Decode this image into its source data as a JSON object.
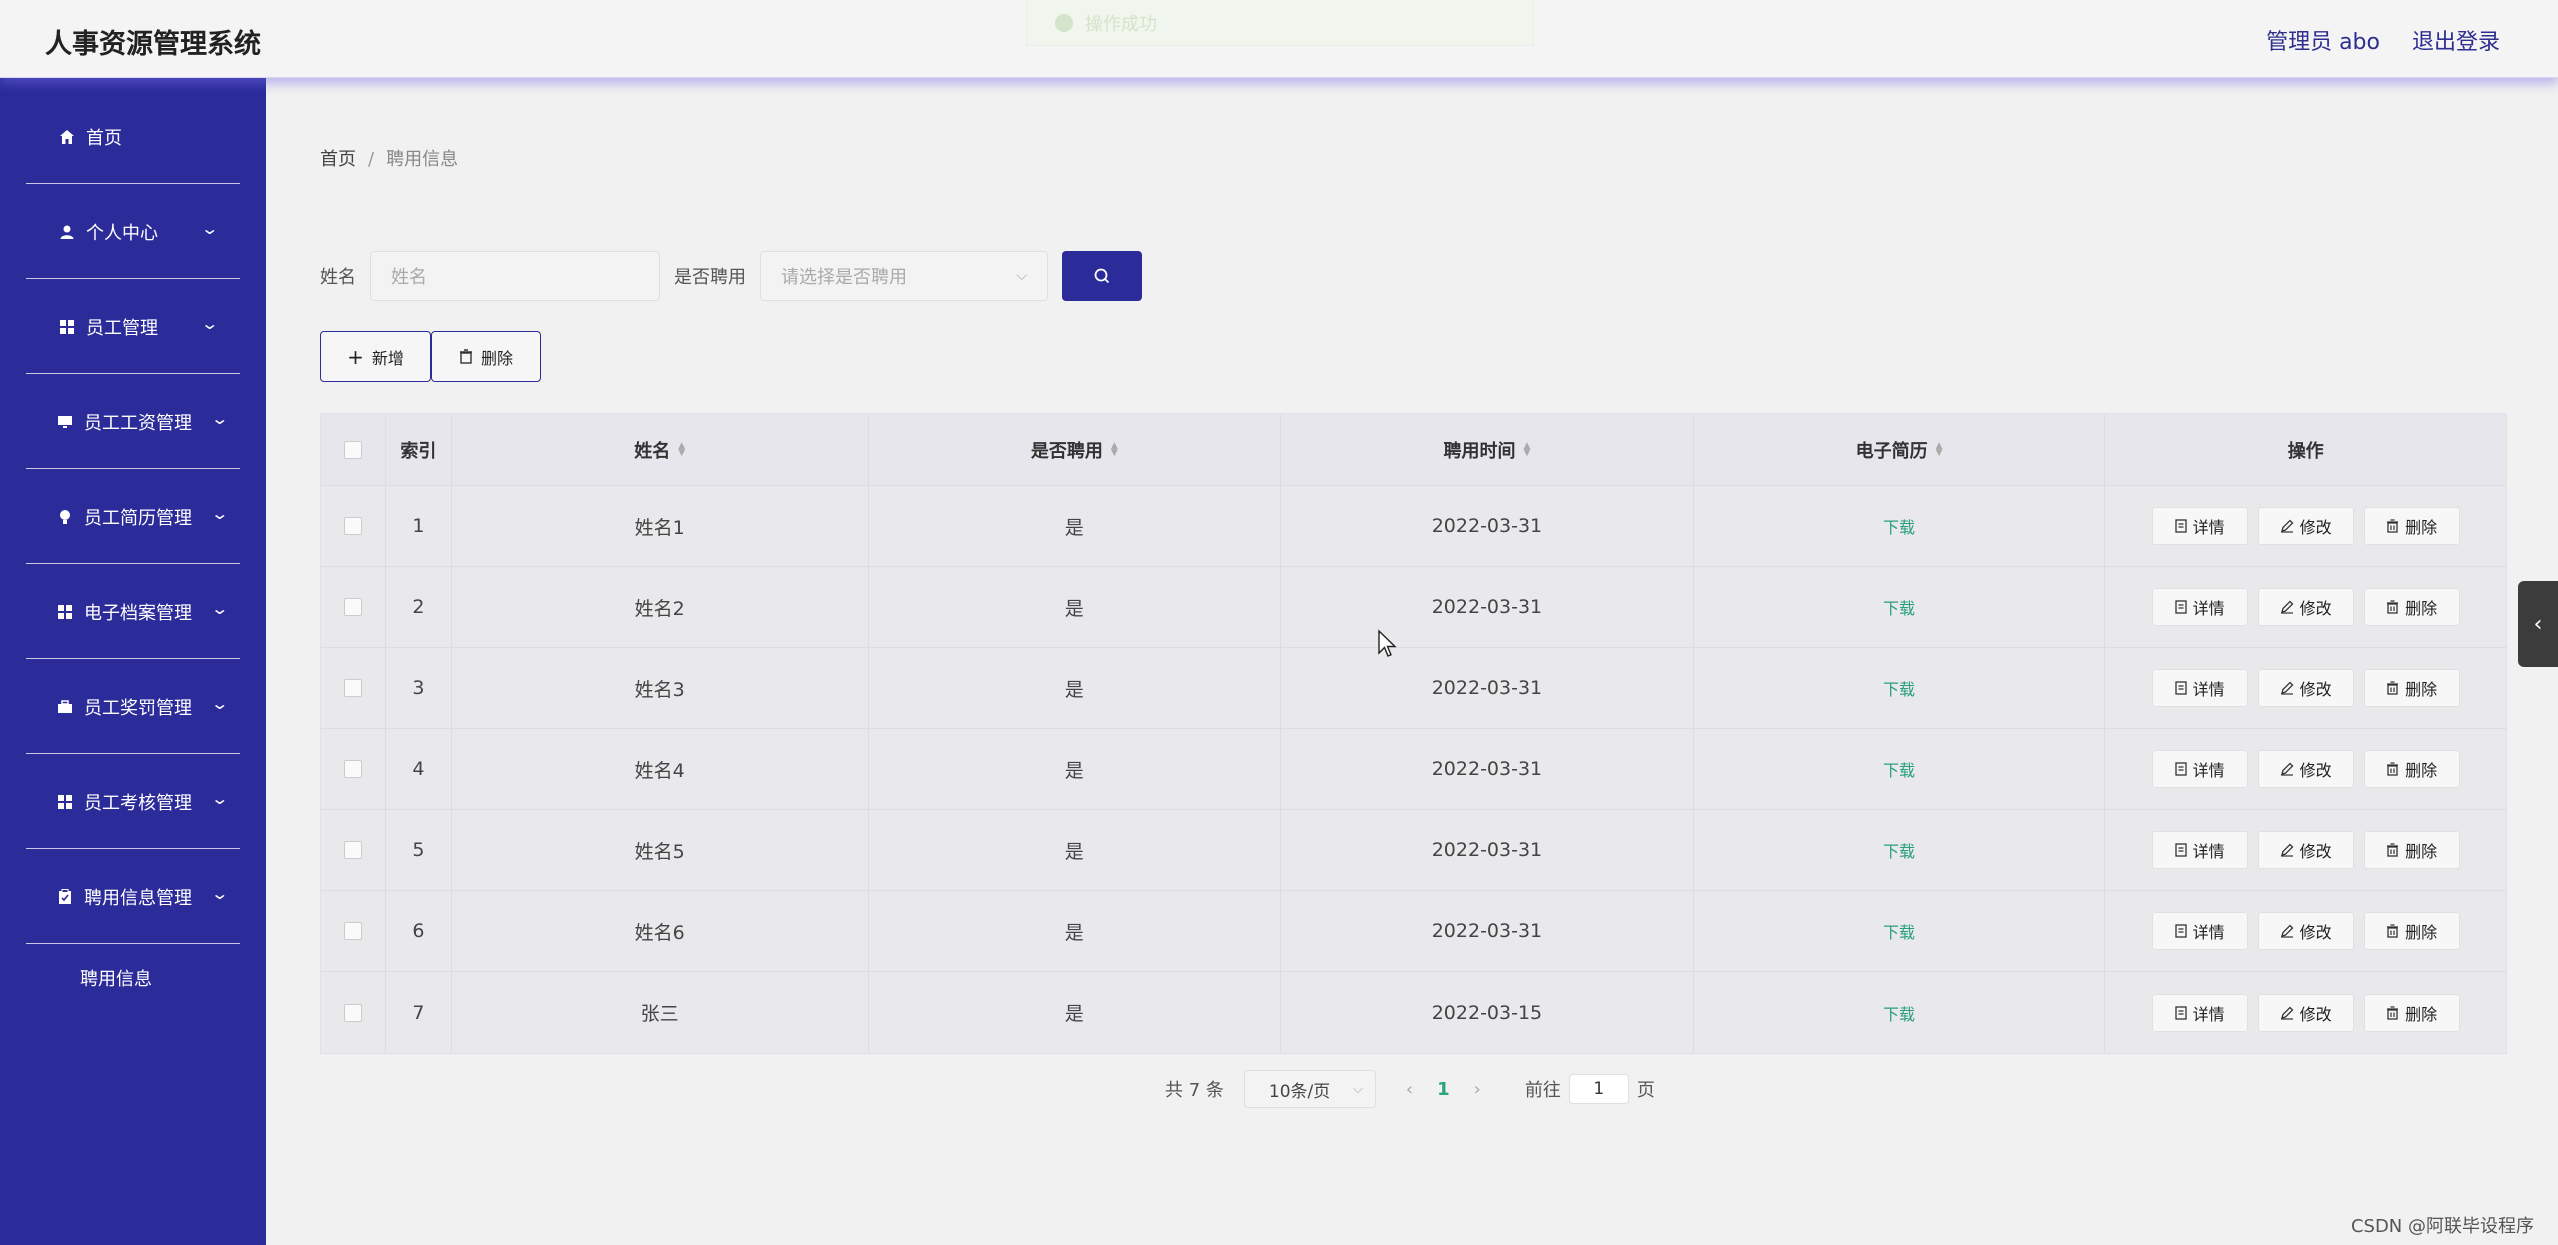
{
  "header": {
    "title": "人事资源管理系统",
    "toast": "操作成功",
    "user": "管理员 abo",
    "logout": "退出登录"
  },
  "sidebar": {
    "items": [
      {
        "label": "首页",
        "icon": "home-icon"
      },
      {
        "label": "个人中心",
        "icon": "user-icon"
      },
      {
        "label": "员工管理",
        "icon": "grid-icon"
      },
      {
        "label": "员工工资管理",
        "icon": "monitor-icon"
      },
      {
        "label": "员工简历管理",
        "icon": "bulb-icon"
      },
      {
        "label": "电子档案管理",
        "icon": "grid-icon"
      },
      {
        "label": "员工奖罚管理",
        "icon": "briefcase-icon"
      },
      {
        "label": "员工考核管理",
        "icon": "grid-icon"
      },
      {
        "label": "聘用信息管理",
        "icon": "clipboard-icon"
      }
    ],
    "sub_item": "聘用信息"
  },
  "breadcrumb": {
    "home": "首页",
    "sep": "/",
    "current": "聘用信息"
  },
  "search": {
    "name_label": "姓名",
    "name_placeholder": "姓名",
    "hired_label": "是否聘用",
    "hired_placeholder": "请选择是否聘用"
  },
  "toolbar": {
    "add": "新增",
    "delete": "删除"
  },
  "table": {
    "headers": [
      "索引",
      "姓名",
      "是否聘用",
      "聘用时间",
      "电子简历",
      "操作"
    ],
    "rows": [
      {
        "index": "1",
        "name": "姓名1",
        "hired": "是",
        "date": "2022-03-31",
        "resume": "下载"
      },
      {
        "index": "2",
        "name": "姓名2",
        "hired": "是",
        "date": "2022-03-31",
        "resume": "下载"
      },
      {
        "index": "3",
        "name": "姓名3",
        "hired": "是",
        "date": "2022-03-31",
        "resume": "下载"
      },
      {
        "index": "4",
        "name": "姓名4",
        "hired": "是",
        "date": "2022-03-31",
        "resume": "下载"
      },
      {
        "index": "5",
        "name": "姓名5",
        "hired": "是",
        "date": "2022-03-31",
        "resume": "下载"
      },
      {
        "index": "6",
        "name": "姓名6",
        "hired": "是",
        "date": "2022-03-31",
        "resume": "下载"
      },
      {
        "index": "7",
        "name": "张三",
        "hired": "是",
        "date": "2022-03-15",
        "resume": "下载"
      }
    ],
    "actions": {
      "detail": "详情",
      "edit": "修改",
      "delete": "删除"
    }
  },
  "pagination": {
    "total": "共 7 条",
    "page_size": "10条/页",
    "current": "1",
    "goto_label": "前往",
    "goto_value": "1",
    "page_suffix": "页"
  },
  "watermark": "CSDN @阿联毕设程序",
  "colors": {
    "primary": "#2b2b9a",
    "download": "#29a07a",
    "page_active": "#2ba37c"
  }
}
